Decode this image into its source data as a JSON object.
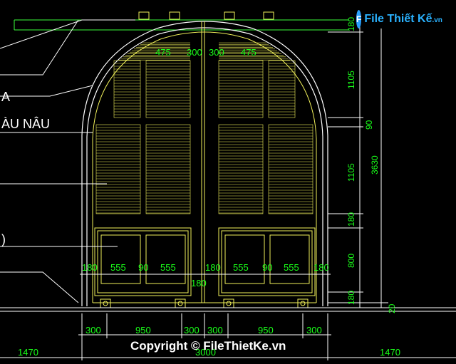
{
  "logo": {
    "mark": "F",
    "name": "File Thiết Kế",
    "tld": ".vn"
  },
  "labels": {
    "label_a": "A",
    "label_nau": "ÀU NÂU",
    "label_paren": ")"
  },
  "dimensions": {
    "top_louver_w_left": "475",
    "top_gap_left": "300",
    "top_gap_right": "300",
    "top_louver_w_right": "475",
    "v_top": "180",
    "v_arch": "1105",
    "v_mid": "90",
    "v_louver": "1105",
    "v_total": "3630",
    "v_rail": "180",
    "v_panel": "800",
    "v_bottom": "180",
    "v_floor": "20",
    "panel_edge_1": "180",
    "panel_w_1": "555",
    "panel_mid_1": "90",
    "panel_w_2": "555",
    "panel_center": "180",
    "panel_w_3": "555",
    "panel_mid_2": "90",
    "panel_w_4": "555",
    "panel_edge_2": "180",
    "center_below": "180",
    "bottom_300_1": "300",
    "bottom_950_1": "950",
    "bottom_300_2": "300",
    "bottom_300_3": "300",
    "bottom_950_2": "950",
    "bottom_300_4": "300",
    "side_left": "1470",
    "total_width": "3000",
    "side_right": "1470"
  },
  "watermark": "Copyright © FileThietKe.vn",
  "colors": {
    "background": "#000000",
    "door_lines": "#f0f05a",
    "dimension_text": "#19ff19",
    "annotation_lines": "#ffffff",
    "frame_green": "#3cff3c"
  }
}
